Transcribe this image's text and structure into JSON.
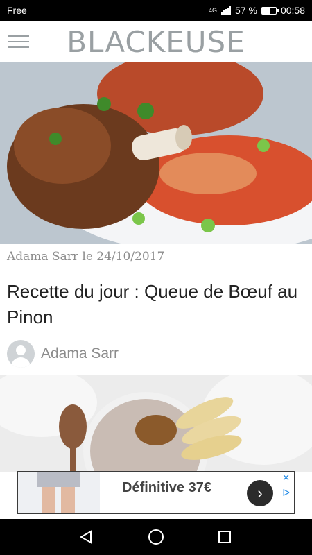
{
  "status_bar": {
    "carrier": "Free",
    "network": "4G",
    "battery": "57 %",
    "time": "00:58"
  },
  "app": {
    "brand": "BLACKEUSE"
  },
  "post": {
    "meta": "Adama Sarr le 24/10/2017",
    "title": "Recette du jour : Queue de Bœuf au Pinon",
    "author": "Adama Sarr"
  },
  "ad": {
    "text": "Définitive 37€",
    "close": "✕",
    "choices": "ᐅ"
  },
  "colors": {
    "brand": "#9aa0a3",
    "meta": "#8c8c8c",
    "ad_accent": "#1e88e5"
  }
}
